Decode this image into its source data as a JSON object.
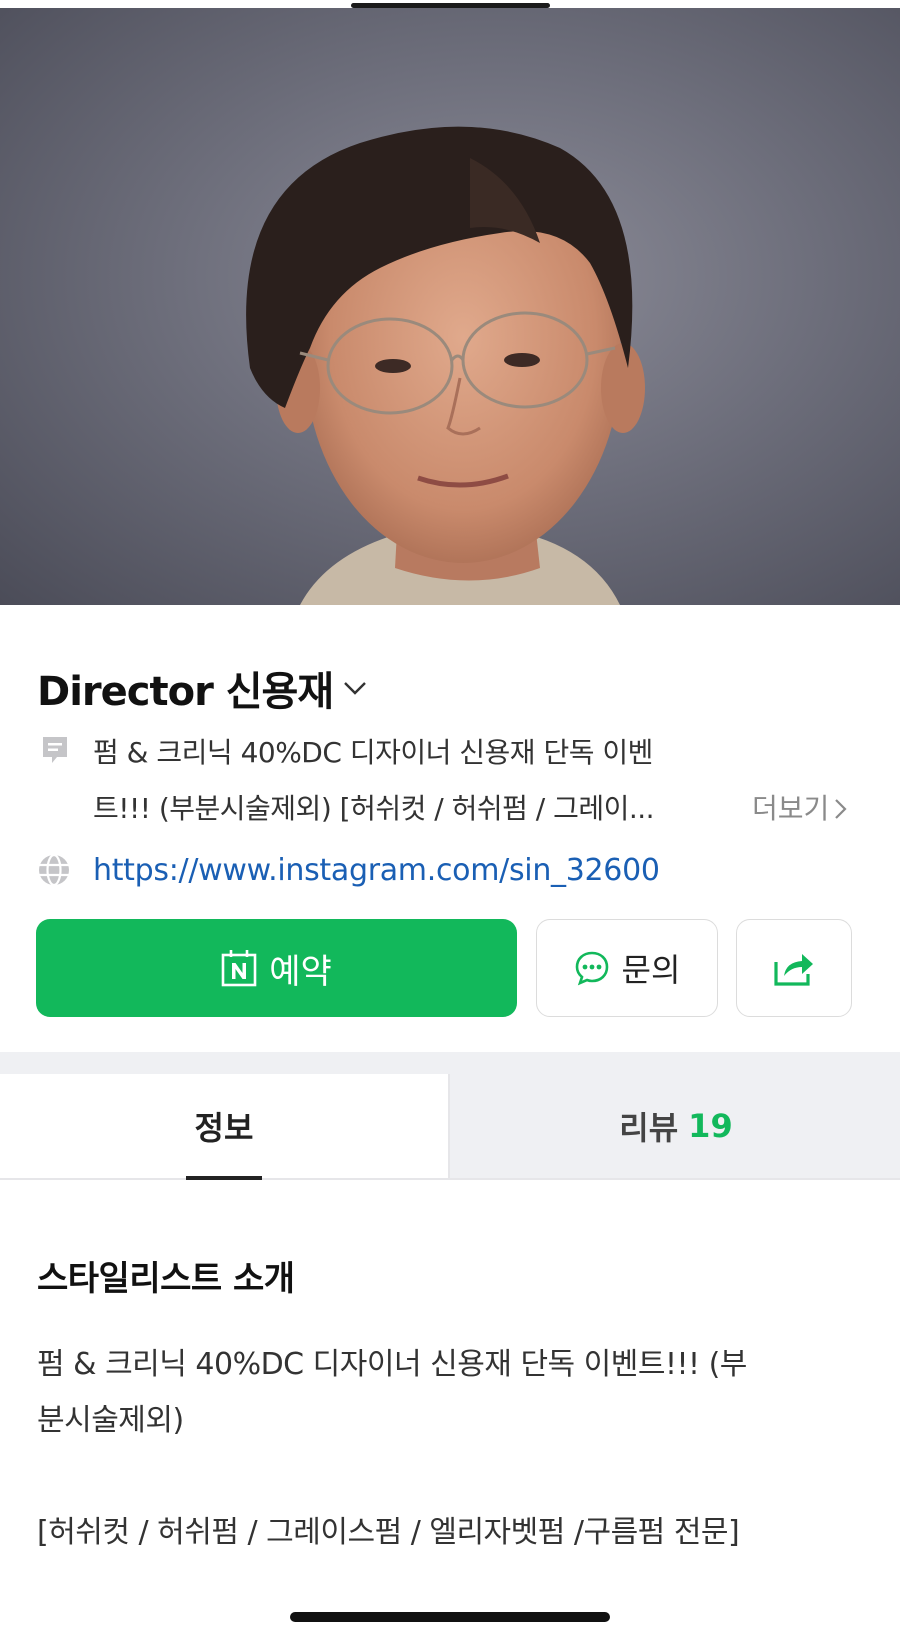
{
  "profile": {
    "name": "Director 신용재",
    "description_lines": [
      "펌 & 크리닉 40%DC 디자이너 신용재 단독 이벤",
      "트!!! (부분시술제외) [허쉬컷 / 허쉬펌 / 그레이..."
    ],
    "more_label": "더보기",
    "instagram_url": "https://www.instagram.com/sin_32600"
  },
  "actions": {
    "reserve_label": "예약",
    "inquiry_label": "문의"
  },
  "tabs": [
    {
      "label": "정보",
      "active": true
    },
    {
      "label": "리뷰",
      "count": "19",
      "active": false
    }
  ],
  "section": {
    "title": "스타일리스트 소개",
    "intro_lines": [
      "펌 & 크리닉 40%DC 디자이너 신용재 단독 이벤트!!! (부",
      "분시술제외)",
      "",
      "[허쉬컷 / 허쉬펌 / 그레이스펌 / 엘리자벳펌 /구름펌 전문]"
    ]
  },
  "colors": {
    "accent_green": "#12b85b",
    "link_blue": "#1a5fb4"
  },
  "icons": [
    "chevron-down-icon",
    "description-icon",
    "globe-icon",
    "naver-booking-icon",
    "chat-icon",
    "share-icon",
    "chevron-right-icon"
  ]
}
